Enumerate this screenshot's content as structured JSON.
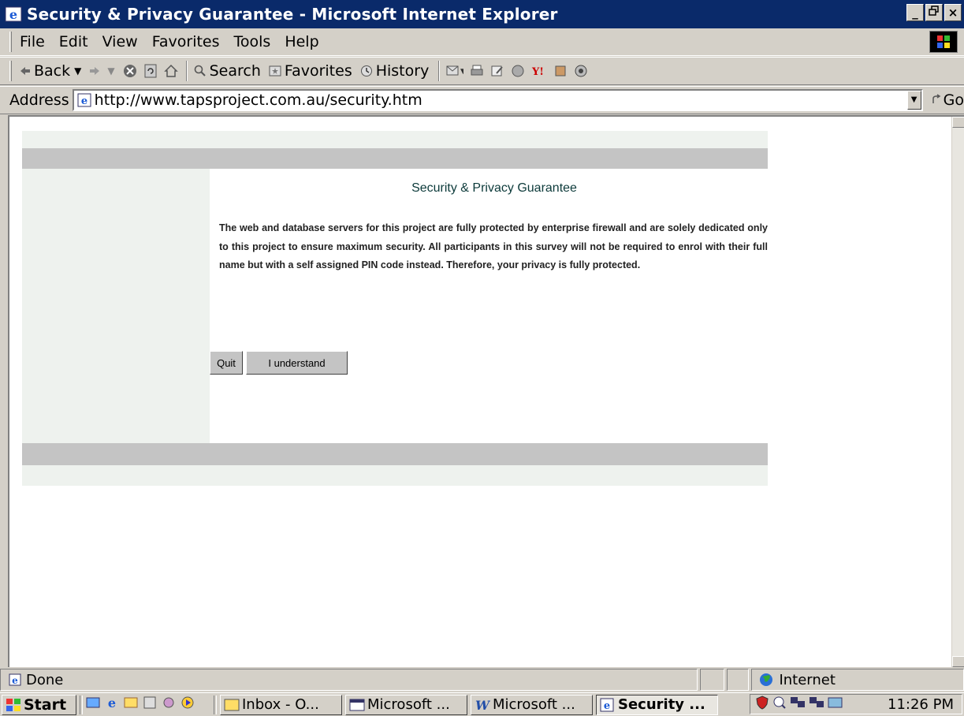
{
  "window": {
    "title": "Security & Privacy Guarantee - Microsoft Internet Explorer",
    "controls": [
      "_",
      "2",
      "x"
    ]
  },
  "menu": [
    {
      "label": "File"
    },
    {
      "label": "Edit"
    },
    {
      "label": "View"
    },
    {
      "label": "Favorites"
    },
    {
      "label": "Tools"
    },
    {
      "label": "Help"
    }
  ],
  "toolbar": {
    "back": "Back",
    "search": "Search",
    "favorites": "Favorites",
    "history": "History"
  },
  "address": {
    "label": "Address",
    "url": "http://www.tapsproject.com.au/security.htm",
    "go": "Go"
  },
  "page": {
    "heading": "Security & Privacy Guarantee",
    "body": "The web and database servers for this project are fully protected by enterprise firewall and are solely dedicated only to this project to ensure maximum security. All participants in this survey will not be required to enrol with their full name but with a self assigned PIN code instead. Therefore, your privacy is fully protected.",
    "quit_label": "Quit",
    "understand_label": "I understand"
  },
  "status": {
    "text": "Done",
    "zone": "Internet"
  },
  "taskbar": {
    "start": "Start",
    "tasks": [
      {
        "label": "Inbox - O..."
      },
      {
        "label": "Microsoft ..."
      },
      {
        "label": "Microsoft ..."
      },
      {
        "label": "Security ..."
      }
    ],
    "clock": "11:26 PM"
  },
  "colors": {
    "titlebar": "#0a2a6a",
    "page_band_light": "#eef2ee",
    "page_band_gray": "#c4c4c4",
    "heading": "#0c3a3a"
  }
}
